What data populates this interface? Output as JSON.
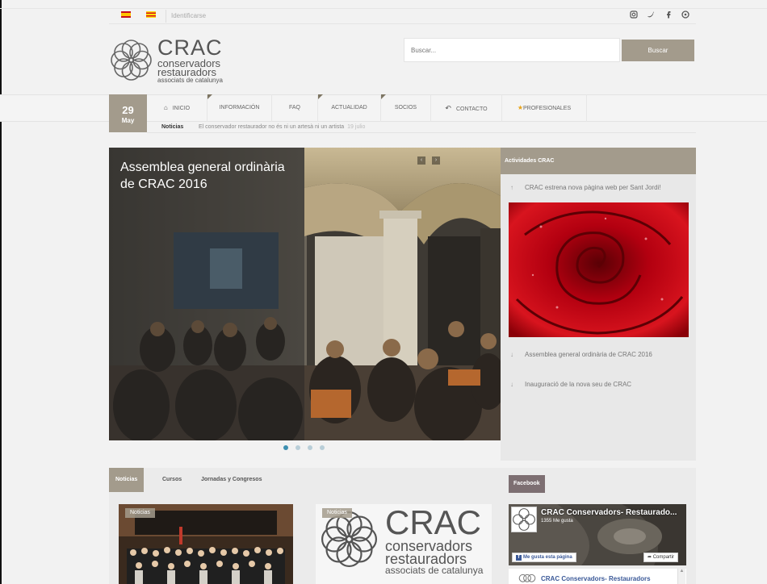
{
  "topbar": {
    "login_text": "Identificarse",
    "languages": [
      "es",
      "ca"
    ],
    "social_icons": [
      "instagram-icon",
      "twitter-icon",
      "facebook-icon",
      "pinterest-icon"
    ]
  },
  "header": {
    "logo": {
      "name": "CRAC",
      "line1": "conservadors",
      "line2": "restauradors",
      "line3": "associats de catalunya"
    },
    "search": {
      "placeholder": "Buscar...",
      "button_label": "Buscar"
    }
  },
  "date": {
    "day": "29",
    "month": "May"
  },
  "nav": {
    "items": [
      {
        "label": "INICIO",
        "icon": "home-icon"
      },
      {
        "label": "INFORMACIÓN"
      },
      {
        "label": "FAQ"
      },
      {
        "label": "ACTUALIDAD"
      },
      {
        "label": "SOCIOS"
      },
      {
        "label": "CONTACTO",
        "icon": "reply-icon"
      },
      {
        "label": "PROFESIONALES",
        "icon": "star-icon"
      }
    ]
  },
  "news_ticker": {
    "label": "Noticias",
    "text": "El conservador restaurador no és ni un artesà ni un artista",
    "date": "19 julio"
  },
  "slider": {
    "title": "Assemblea general ordinària de CRAC 2016",
    "dots": 4,
    "active_dot": 0
  },
  "activities": {
    "header": "Actividades CRAC",
    "items": [
      "CRAC estrena nova pàgina web per Sant Jordi!",
      "Assemblea general ordinària de CRAC 2016",
      "Inauguració de la nova seu de CRAC"
    ]
  },
  "tabs": {
    "items": [
      "Noticias",
      "Cursos",
      "Jornadas y Congresos"
    ],
    "active": 0
  },
  "cards": {
    "badge": "Noticias"
  },
  "facebook": {
    "tab_label": "Facebook",
    "page_name": "CRAC Conservadors- Restaurado...",
    "likes": "1355 Me gusta",
    "like_button": "Me gusta esta página",
    "share_button": "Compartir",
    "post_author": "CRAC Conservadors- Restauradors"
  },
  "colors": {
    "accent": "#a39b8c",
    "accent_dark": "#7d7563",
    "facebook_tab": "#7d6f72",
    "dot_active": "#3d8fb0",
    "dot_inactive": "#b9ced8"
  }
}
